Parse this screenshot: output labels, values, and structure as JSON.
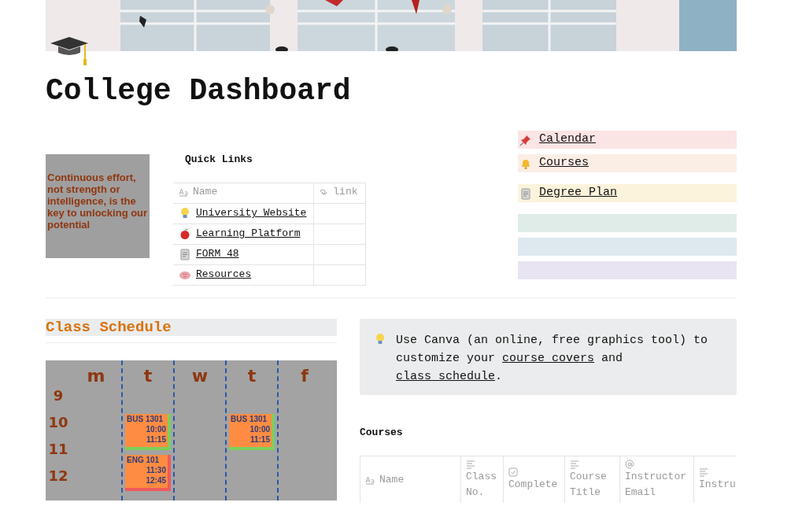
{
  "page": {
    "title": "College Dashboard"
  },
  "quote": {
    "text": "Continuous effort, not strength or intelligence, is the key to unlocking our potential"
  },
  "quick_links": {
    "title": "Quick Links",
    "columns": [
      "Name",
      "link"
    ],
    "rows": [
      {
        "name": "University Website"
      },
      {
        "name": "Learning Platform"
      },
      {
        "name": "FORM 48"
      },
      {
        "name": "Resources"
      }
    ]
  },
  "nav_bars": [
    {
      "label": "Calendar",
      "color": "#fbe4e4"
    },
    {
      "label": "Courses",
      "color": "#fbeee4"
    },
    {
      "label": "Degree Plan",
      "color": "#fbf3db"
    },
    {
      "color": "#dfece8"
    },
    {
      "color": "#dde9ef"
    },
    {
      "color": "#e8e4f1"
    }
  ],
  "class_schedule": {
    "title": "Class Schedule",
    "hours": [
      "9",
      "10",
      "11",
      "12"
    ],
    "days": [
      {
        "label": "m"
      },
      {
        "label": "t",
        "blocks": [
          {
            "course": "BUS 1301",
            "start": "10:00",
            "end": "11:15",
            "color": "#7ccf5a"
          },
          {
            "course": "ENG 101",
            "start": "11:30",
            "end": "12:45",
            "color": "#ef5a5a"
          }
        ]
      },
      {
        "label": "w"
      },
      {
        "label": "t",
        "blocks": [
          {
            "course": "BUS 1301",
            "start": "10:00",
            "end": "11:15",
            "color": "#7ccf5a"
          }
        ]
      },
      {
        "label": "f"
      }
    ]
  },
  "callout": {
    "text": "Use Canva (an online, free graphics tool) to customize your ",
    "link1": "course covers",
    "middle": " and ",
    "link2": "class schedule",
    "end": "."
  },
  "courses": {
    "title": "Courses",
    "columns": [
      "Name",
      "Class No.",
      "Complete",
      "Course Title",
      "Instructor Email",
      "Instru"
    ]
  }
}
